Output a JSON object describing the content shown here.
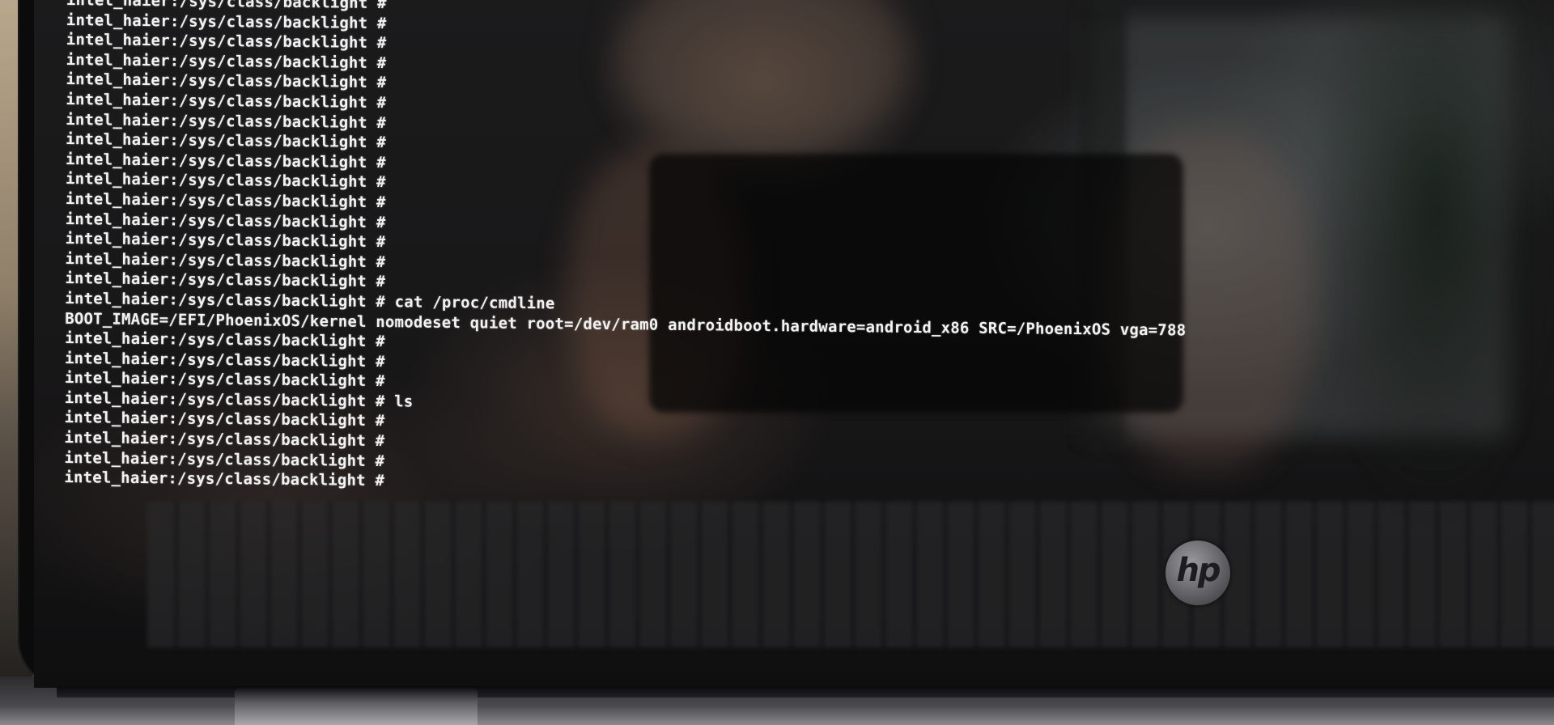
{
  "terminal": {
    "lines": [
      "intel_haier:/sys/class/backlight #",
      "intel_haier:/sys/class/backlight #",
      "intel_haier:/sys/class/backlight #",
      "intel_haier:/sys/class/backlight #",
      "intel_haier:/sys/class/backlight #",
      "intel_haier:/sys/class/backlight #",
      "intel_haier:/sys/class/backlight #",
      "intel_haier:/sys/class/backlight #",
      "intel_haier:/sys/class/backlight #",
      "intel_haier:/sys/class/backlight #",
      "intel_haier:/sys/class/backlight #",
      "intel_haier:/sys/class/backlight #",
      "intel_haier:/sys/class/backlight #",
      "intel_haier:/sys/class/backlight #",
      "intel_haier:/sys/class/backlight #",
      "intel_haier:/sys/class/backlight # cat /proc/cmdline",
      "BOOT_IMAGE=/EFI/PhoenixOS/kernel nomodeset quiet root=/dev/ram0 androidboot.hardware=android_x86 SRC=/PhoenixOS vga=788",
      "intel_haier:/sys/class/backlight #",
      "intel_haier:/sys/class/backlight #",
      "intel_haier:/sys/class/backlight #",
      "intel_haier:/sys/class/backlight # ls",
      "intel_haier:/sys/class/backlight #",
      "intel_haier:/sys/class/backlight #",
      "intel_haier:/sys/class/backlight #",
      "intel_haier:/sys/class/backlight #"
    ]
  },
  "laptop": {
    "logo_text": "hp",
    "logo_icon": "hp-logo-icon"
  },
  "colors": {
    "terminal_text": "#f2f2f2",
    "screen_background": "#181718",
    "bezel": "#0b0b0c"
  }
}
